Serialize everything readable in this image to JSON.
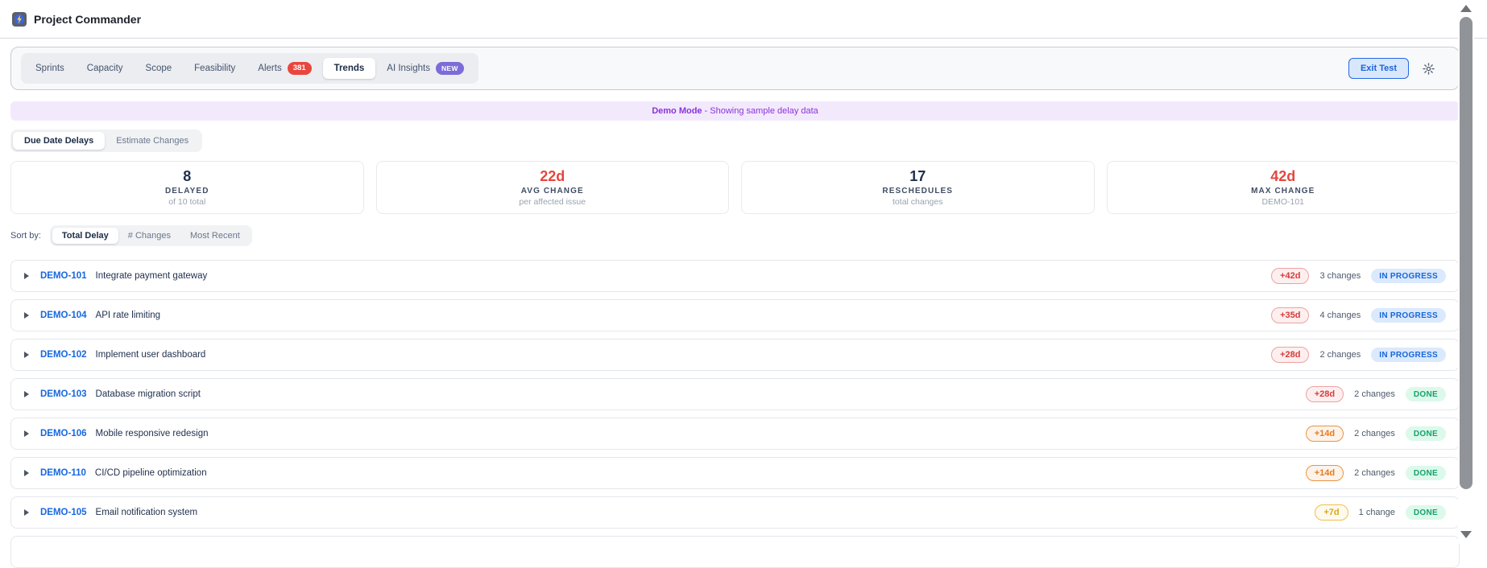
{
  "header": {
    "title": "Project Commander"
  },
  "tabbar": {
    "items": [
      {
        "label": "Sprints"
      },
      {
        "label": "Capacity"
      },
      {
        "label": "Scope"
      },
      {
        "label": "Feasibility"
      },
      {
        "label": "Alerts",
        "badge": "381"
      },
      {
        "label": "Trends",
        "active": true
      },
      {
        "label": "AI Insights",
        "badge": "NEW"
      }
    ],
    "exit_button_label": "Exit Test"
  },
  "banner": {
    "bold": "Demo Mode",
    "text": "- Showing sample delay data"
  },
  "view_toggle": {
    "options": [
      {
        "label": "Due Date Delays",
        "active": true
      },
      {
        "label": "Estimate Changes",
        "active": false
      }
    ]
  },
  "stats": [
    {
      "value": "8",
      "label": "DELAYED",
      "sub": "of 10 total"
    },
    {
      "value": "22d",
      "label": "AVG CHANGE",
      "sub": "per affected issue"
    },
    {
      "value": "17",
      "label": "RESCHEDULES",
      "sub": "total changes"
    },
    {
      "value": "42d",
      "label": "MAX CHANGE",
      "sub": "DEMO-101"
    }
  ],
  "sort": {
    "label": "Sort by:",
    "options": [
      {
        "label": "Total Delay",
        "active": true
      },
      {
        "label": "# Changes",
        "active": false
      },
      {
        "label": "Most Recent",
        "active": false
      }
    ]
  },
  "issues": [
    {
      "key": "DEMO-101",
      "summary": "Integrate payment gateway",
      "delay": "+42d",
      "severity": "red",
      "changes": "3 changes",
      "status": "IN PROGRESS"
    },
    {
      "key": "DEMO-104",
      "summary": "API rate limiting",
      "delay": "+35d",
      "severity": "red",
      "changes": "4 changes",
      "status": "IN PROGRESS"
    },
    {
      "key": "DEMO-102",
      "summary": "Implement user dashboard",
      "delay": "+28d",
      "severity": "red",
      "changes": "2 changes",
      "status": "IN PROGRESS"
    },
    {
      "key": "DEMO-103",
      "summary": "Database migration script",
      "delay": "+28d",
      "severity": "red",
      "changes": "2 changes",
      "status": "DONE"
    },
    {
      "key": "DEMO-106",
      "summary": "Mobile responsive redesign",
      "delay": "+14d",
      "severity": "orange",
      "changes": "2 changes",
      "status": "DONE"
    },
    {
      "key": "DEMO-110",
      "summary": "CI/CD pipeline optimization",
      "delay": "+14d",
      "severity": "orange",
      "changes": "2 changes",
      "status": "DONE"
    },
    {
      "key": "DEMO-105",
      "summary": "Email notification system",
      "delay": "+7d",
      "severity": "amber",
      "changes": "1 change",
      "status": "DONE"
    }
  ],
  "colors": {
    "accent_blue": "#1767e0",
    "danger_red": "#e5463c",
    "warning_orange": "#e67a1e",
    "caution_amber": "#dda519",
    "success_green": "#16a26a",
    "banner_purple": "#8b33d9",
    "alerts_badge_bg": "#e8463f",
    "new_badge_bg": "#7b6cd9"
  }
}
